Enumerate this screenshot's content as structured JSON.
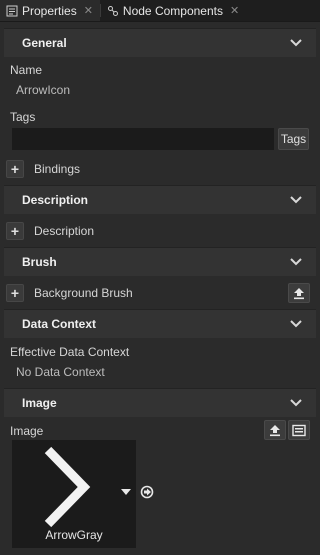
{
  "tabs": [
    {
      "label": "Properties"
    },
    {
      "label": "Node Components"
    }
  ],
  "sections": {
    "general": "General",
    "description": "Description",
    "brush": "Brush",
    "data_context": "Data Context",
    "image": "Image"
  },
  "general": {
    "name_label": "Name",
    "name_value": "ArrowIcon",
    "tags_label": "Tags",
    "tags_value": "",
    "tags_button": "Tags",
    "bindings_label": "Bindings"
  },
  "description": {
    "item_label": "Description"
  },
  "brush": {
    "item_label": "Background Brush"
  },
  "data_context": {
    "effective_label": "Effective Data Context",
    "effective_value": "No Data Context"
  },
  "image": {
    "image_label": "Image",
    "asset_name": "ArrowGray"
  },
  "colors": {
    "background": "#2b2b2b",
    "header": "#333333",
    "input": "#1b1b1b"
  },
  "icons": [
    "properties-tab-icon",
    "node-components-tab-icon",
    "close-icon",
    "chevron-down-icon",
    "plus-icon",
    "upload-icon",
    "image-browse-icon",
    "dropdown-arrow-icon",
    "goto-arrow-icon"
  ]
}
